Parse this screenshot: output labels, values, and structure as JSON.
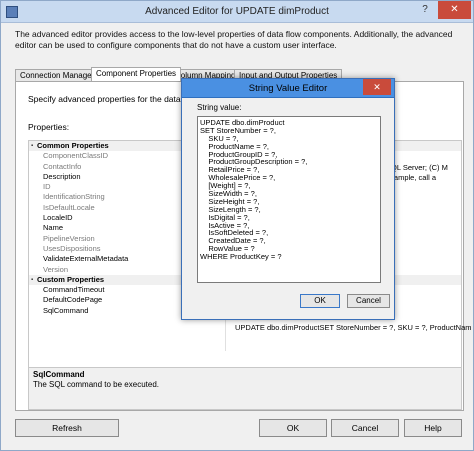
{
  "window": {
    "title": "Advanced Editor for UPDATE dimProduct",
    "help_glyph": "?",
    "close_glyph": "✕",
    "intro": "The advanced editor provides access to the low-level properties of data flow components. Additionally, the advanced editor can be used to configure components that do not have a custom user interface."
  },
  "tabs": [
    {
      "label": "Connection Managers"
    },
    {
      "label": "Component Properties"
    },
    {
      "label": "Column Mappings"
    },
    {
      "label": "Input and Output Properties"
    }
  ],
  "panel": {
    "description": "Specify advanced properties for the data flow comp",
    "properties_label": "Properties:",
    "right_overflow_1": "SQL Server; (C) M",
    "right_overflow_2": "example, call a"
  },
  "properties": {
    "common_header": "Common Properties",
    "common": [
      {
        "name": "ComponentClassID",
        "dim": true
      },
      {
        "name": "ContactInfo",
        "dim": true
      },
      {
        "name": "Description",
        "dim": false
      },
      {
        "name": "ID",
        "dim": true
      },
      {
        "name": "IdentificationString",
        "dim": true
      },
      {
        "name": "IsDefaultLocale",
        "dim": true
      },
      {
        "name": "LocaleID",
        "dim": false
      },
      {
        "name": "Name",
        "dim": false
      },
      {
        "name": "PipelineVersion",
        "dim": true
      },
      {
        "name": "UsesDispositions",
        "dim": true
      },
      {
        "name": "ValidateExternalMetadata",
        "dim": false
      },
      {
        "name": "Version",
        "dim": true
      }
    ],
    "custom_header": "Custom Properties",
    "custom": [
      {
        "name": "CommandTimeout"
      },
      {
        "name": "DefaultCodePage"
      },
      {
        "name": "SqlCommand"
      }
    ],
    "sql_value": "UPDATE dbo.dimProductSET StoreNumber = ?,   SKU = ?,   ProductNam"
  },
  "description_box": {
    "title": "SqlCommand",
    "text": "The SQL command to be executed."
  },
  "buttons": {
    "refresh": "Refresh",
    "ok": "OK",
    "cancel": "Cancel",
    "help": "Help"
  },
  "dialog": {
    "title": "String Value Editor",
    "close_glyph": "✕",
    "label": "String value:",
    "lines": [
      "UPDATE dbo.dimProduct",
      "SET StoreNumber = ?,",
      "    SKU = ?,",
      "    ProductName = ?,",
      "    ProductGroupID = ?,",
      "    ProductGroupDescription = ?,",
      "    RetailPrice = ?,",
      "    WholesalePrice = ?,",
      "    [Weight] = ?,",
      "    SizeWidth = ?,",
      "    SizeHeight = ?,",
      "    SizeLength = ?,",
      "    IsDigital = ?,",
      "    IsActive = ?,",
      "    IsSoftDeleted = ?,",
      "    CreatedDate = ?,",
      "    RowValue = ?",
      "WHERE ProductKey = ?"
    ],
    "ok": "OK",
    "cancel": "Cancel"
  }
}
